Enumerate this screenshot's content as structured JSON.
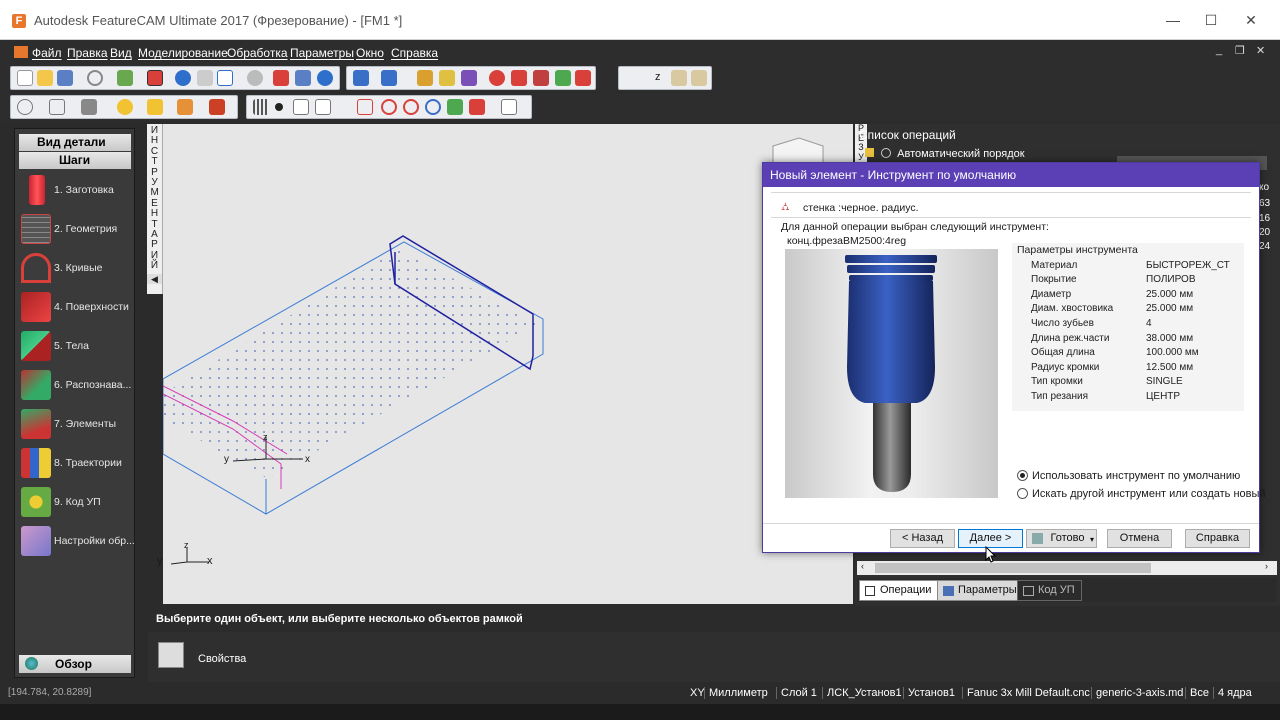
{
  "window": {
    "app_icon_letter": "F",
    "title": "Autodesk FeatureCAM Ultimate 2017 (Фрезерование) - [FM1 *]",
    "minimize": "—",
    "maximize": "☐",
    "close": "✕"
  },
  "menu": {
    "items": [
      "Файл",
      "Правка",
      "Вид",
      "Моделирование",
      "Обработка",
      "Параметры",
      "Окно",
      "Справка"
    ],
    "mdi_minimize": "_",
    "mdi_restore": "❐",
    "mdi_close": "✕"
  },
  "toolbar2": {
    "xyz_label": "z"
  },
  "left_panel": {
    "header": "Вид детали",
    "subheader": "Шаги",
    "steps": [
      {
        "label": "1.  Заготовка"
      },
      {
        "label": "2.  Геометрия"
      },
      {
        "label": "3.  Кривые"
      },
      {
        "label": "4.  Поверхности"
      },
      {
        "label": "5.  Тела"
      },
      {
        "label": "6.  Распознава..."
      },
      {
        "label": "7.  Элементы"
      },
      {
        "label": "8.  Траектории"
      },
      {
        "label": "9.  Код УП"
      },
      {
        "label": "Настройки обр..."
      }
    ],
    "footer": "Обзор"
  },
  "vertical_tab": "ИНСТРУМЕНТАРИЙ",
  "viewport": {
    "axis_x": "x",
    "axis_y": "y",
    "axis_z": "z"
  },
  "ops_panel": {
    "vtab": "РЕЗУ",
    "title": "Список операций",
    "auto_order": "Автоматический порядок",
    "partial_col_header": "ко",
    "partial_values": [
      "63",
      "16",
      "20",
      "24"
    ],
    "tabs": [
      "Операции",
      "Параметры",
      "Код УП"
    ]
  },
  "dialog": {
    "title": "Новый элемент - Инструмент по умолчанию",
    "feature": "стенка :черное. радиус.",
    "message": "Для данной операции выбран следующий инструмент:",
    "tool_name": "конц.фрезаBM2500:4reg",
    "params_title": "Параметры инструмента",
    "params": [
      {
        "name": "Материал",
        "value": "БЫСТРОРЕЖ_СТ"
      },
      {
        "name": "Покрытие",
        "value": "ПОЛИРОВ"
      },
      {
        "name": "Диаметр",
        "value": "25.000 мм"
      },
      {
        "name": "Диам. хвостовика",
        "value": "25.000 мм"
      },
      {
        "name": "Число зубьев",
        "value": "4"
      },
      {
        "name": "Длина реж.части",
        "value": "38.000 мм"
      },
      {
        "name": "Общая длина",
        "value": "100.000 мм"
      },
      {
        "name": "Радиус кромки",
        "value": "12.500 мм"
      },
      {
        "name": "Тип кромки",
        "value": "SINGLE"
      },
      {
        "name": "Тип резания",
        "value": "ЦЕНТР"
      }
    ],
    "option_default": "Использовать инструмент по умолчанию",
    "option_other": "Искать другой инструмент или создать новый",
    "btn_back": "< Назад",
    "btn_next": "Далее >",
    "btn_done": "Готово",
    "btn_cancel": "Отмена",
    "btn_help": "Справка"
  },
  "prompt": "Выберите один объект, или выберите несколько объектов рамкой",
  "properties_label": "Свойства",
  "status": {
    "coords": "[194.784, 20.8289]",
    "fields": [
      "XY",
      "Миллиметр",
      "Слой 1",
      "ЛСК_Установ1",
      "Установ1",
      "Fanuc 3x Mill Default.cnc",
      "generic-3-axis.md",
      "Все",
      "4 ядра"
    ]
  },
  "colors": {
    "dialog_title": "#5a3fb5",
    "tool_body": "#2b4e9e",
    "wire_blue": "#3b7bd6",
    "wire_magenta": "#d63bb8"
  }
}
